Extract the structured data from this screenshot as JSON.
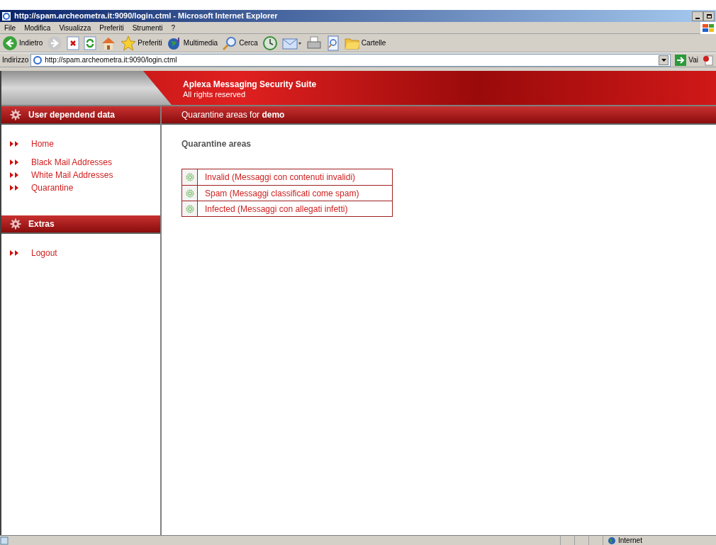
{
  "window": {
    "title": "http://spam.archeometra.it:9090/login.ctml - Microsoft Internet Explorer"
  },
  "menu": [
    "File",
    "Modifica",
    "Visualizza",
    "Preferiti",
    "Strumenti",
    "?"
  ],
  "toolbar": [
    {
      "kind": "back",
      "label": "Indietro"
    },
    {
      "kind": "forward"
    },
    {
      "kind": "stop"
    },
    {
      "kind": "refresh"
    },
    {
      "kind": "home"
    },
    {
      "kind": "favorites",
      "label": "Preferiti"
    },
    {
      "kind": "media",
      "label": "Multimedia"
    },
    {
      "kind": "search",
      "label": "Cerca"
    },
    {
      "kind": "history"
    },
    {
      "kind": "mail"
    },
    {
      "kind": "print"
    },
    {
      "kind": "edit"
    },
    {
      "kind": "folders",
      "label": "Cartelle"
    }
  ],
  "address_bar": {
    "label": "Indirizzo",
    "value": "http://spam.archeometra.it:9090/login.ctml",
    "go": "Vai"
  },
  "header": {
    "title": "Aplexa Messaging Security Suite",
    "subtitle": "All rights reserved"
  },
  "sidebar": [
    {
      "title": "User dependend data",
      "items": [
        "Home",
        "Black Mail Addresses",
        "White Mail Addresses",
        "Quarantine"
      ]
    },
    {
      "title": "Extras",
      "items": [
        "Logout"
      ]
    }
  ],
  "content": {
    "bar": "Quarantine areas for **demo**",
    "heading": "Quarantine areas",
    "areas": [
      "Invalid (Messaggi con contenuti invalidi)",
      "Spam (Messaggi classificati come spam)",
      "Infected (Messaggi con allegati infetti)"
    ]
  },
  "status_bar": {
    "zone": "Internet"
  }
}
